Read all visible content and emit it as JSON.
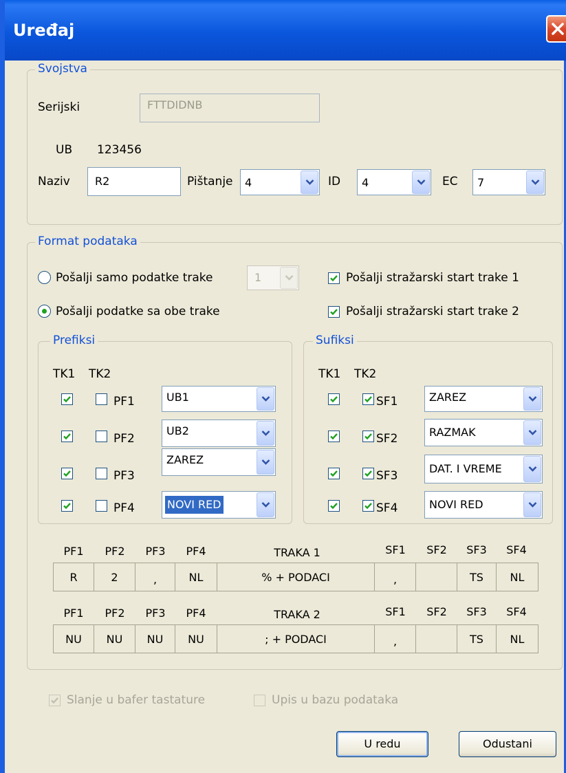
{
  "window": {
    "title": "Uređaj"
  },
  "svojstva": {
    "label": "Svojstva",
    "serijski_label": "Serijski",
    "serijski_value": "FTTDIDNB",
    "ub_label": "UB",
    "ub_value": "123456",
    "naziv_label": "Naziv",
    "naziv_value": "R2",
    "pistanje_label": "Pištanje",
    "pistanje_value": "4",
    "id_label": "ID",
    "id_value": "4",
    "ec_label": "EC",
    "ec_value": "7"
  },
  "format": {
    "label": "Format podataka",
    "radio1_label": "Pošalji samo podatke trake",
    "radio1_checked": false,
    "radio1_combo": "1",
    "radio2_label": "Pošalji podatke sa obe trake",
    "radio2_checked": true,
    "check1_label": "Pošalji stražarski start trake 1",
    "check2_label": "Pošalji stražarski start trake 2"
  },
  "prefiksi": {
    "label": "Prefiksi",
    "tk1": "TK1",
    "tk2": "TK2",
    "rows": [
      {
        "name": "PF1",
        "value": "UB1"
      },
      {
        "name": "PF2",
        "value": "UB2"
      },
      {
        "name": "PF3",
        "value": "ZAREZ"
      },
      {
        "name": "PF4",
        "value": "NOVI RED"
      }
    ]
  },
  "sufiksi": {
    "label": "Sufiksi",
    "tk1": "TK1",
    "tk2": "TK2",
    "rows": [
      {
        "name": "SF1",
        "value": "ZAREZ"
      },
      {
        "name": "SF2",
        "value": "RAZMAK"
      },
      {
        "name": "SF3",
        "value": "DAT. I VREME"
      },
      {
        "name": "SF4",
        "value": "NOVI RED"
      }
    ]
  },
  "preview": {
    "headers1": [
      "PF1",
      "PF2",
      "PF3",
      "PF4",
      "TRAKA 1",
      "SF1",
      "SF2",
      "SF3",
      "SF4"
    ],
    "cells1": [
      "R",
      "2",
      ",",
      "NL",
      "% + PODACI",
      ",",
      "",
      "TS",
      "NL"
    ],
    "headers2": [
      "PF1",
      "PF2",
      "PF3",
      "PF4",
      "TRAKA 2",
      "SF1",
      "SF2",
      "SF3",
      "SF4"
    ],
    "cells2": [
      "NU",
      "NU",
      "NU",
      "NU",
      "; + PODACI",
      ",",
      "",
      "TS",
      "NL"
    ]
  },
  "bottom": {
    "slanje_label": "Slanje u bafer tastature",
    "upis_label": "Upis u bazu podataka",
    "ok_label": "U redu",
    "cancel_label": "Odustani"
  },
  "colors": {
    "title_bar": "#0a56dc",
    "group_label": "#1250d8",
    "dialog_bg": "#ece9d8",
    "check_green": "#21a121"
  }
}
